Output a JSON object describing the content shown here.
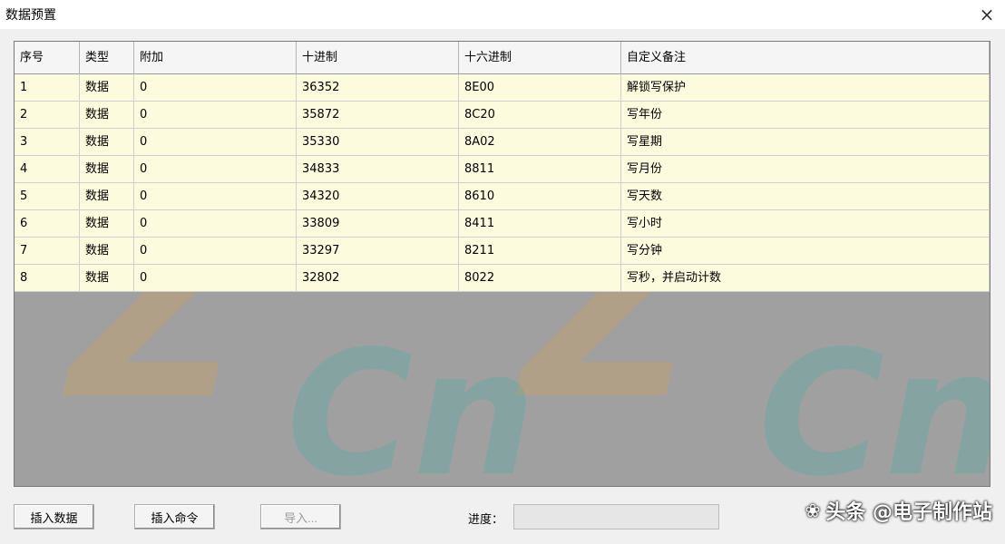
{
  "window": {
    "title": "数据预置",
    "close_icon": "×"
  },
  "table": {
    "columns": [
      "序号",
      "类型",
      "附加",
      "十进制",
      "十六进制",
      "自定义备注"
    ],
    "rows": [
      [
        "1",
        "数据",
        "0",
        "36352",
        "8E00",
        "解锁写保护"
      ],
      [
        "2",
        "数据",
        "0",
        "35872",
        "8C20",
        "写年份"
      ],
      [
        "3",
        "数据",
        "0",
        "35330",
        "8A02",
        "写星期"
      ],
      [
        "4",
        "数据",
        "0",
        "34833",
        "8811",
        "写月份"
      ],
      [
        "5",
        "数据",
        "0",
        "34320",
        "8610",
        "写天数"
      ],
      [
        "6",
        "数据",
        "0",
        "33809",
        "8411",
        "写小时"
      ],
      [
        "7",
        "数据",
        "0",
        "33297",
        "8211",
        "写分钟"
      ],
      [
        "8",
        "数据",
        "0",
        "32802",
        "8022",
        "写秒，并启动计数"
      ]
    ]
  },
  "buttons": {
    "insert_data": "插入数据",
    "insert_command": "插入命令",
    "import": "导入..."
  },
  "progress": {
    "label": "进度：",
    "value": 0
  },
  "watermark": {
    "dz": "DZ",
    "z": "Z",
    "cn": "Cn"
  },
  "brand": {
    "text": "头条 @电子制作站",
    "icon": "wechat-icon"
  },
  "colors": {
    "row_bg": "#fdfbdd",
    "grid_bg": "#a0a0a0",
    "header_bg": "#f5f5f5"
  }
}
